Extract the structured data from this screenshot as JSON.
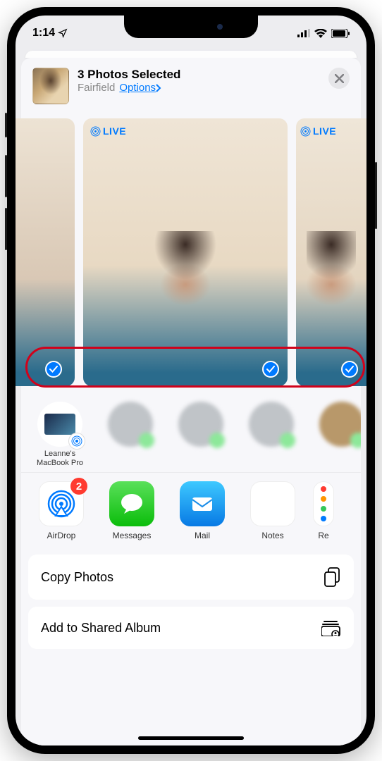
{
  "status": {
    "time": "1:14"
  },
  "header": {
    "title": "3 Photos Selected",
    "location": "Fairfield",
    "options": "Options"
  },
  "photos": {
    "live_badge": "LIVE"
  },
  "airdrop": {
    "macbook_line1": "Leanne's",
    "macbook_line2": "MacBook Pro"
  },
  "apps": {
    "airdrop": "AirDrop",
    "airdrop_badge": "2",
    "messages": "Messages",
    "mail": "Mail",
    "notes": "Notes",
    "reminders": "Re"
  },
  "actions": {
    "copy": "Copy Photos",
    "shared_album": "Add to Shared Album"
  }
}
